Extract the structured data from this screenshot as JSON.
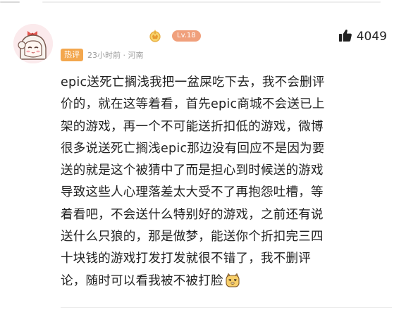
{
  "comment": {
    "author_level": "Lv.18",
    "likes": "4049",
    "hot_tag": "热评",
    "time_location": "23小时前 · 河南",
    "lines": [
      "epic送死亡搁浅我把一盆屎吃下去，我不会删评",
      "价的，就在这等着看，首先epic商城不会送已上",
      "架的游戏，再一个不可能送折扣低的游戏，微博",
      "很多说送死亡搁浅epic那边没有回应不是因为要",
      "送的就是这个被猜中了而是担心到时候送的游戏",
      "导致这些人心理落差太大受不了再抱怨吐槽，等",
      "着看吧，不会送什么特别好的游戏，之前还有说",
      "送什么只狼的，那是做梦，能送你个折扣完三四",
      "十块钱的游戏打发打发就很不错了，我不删评",
      "论，随时可以看我被不被打脸"
    ],
    "trailing_emoji": "smirk-cat-emoji"
  },
  "colors": {
    "level_badge": "#f0a07c",
    "hot_tag": "#f3a74e",
    "meta_text": "#9b9b9b",
    "body_text": "#222222"
  }
}
